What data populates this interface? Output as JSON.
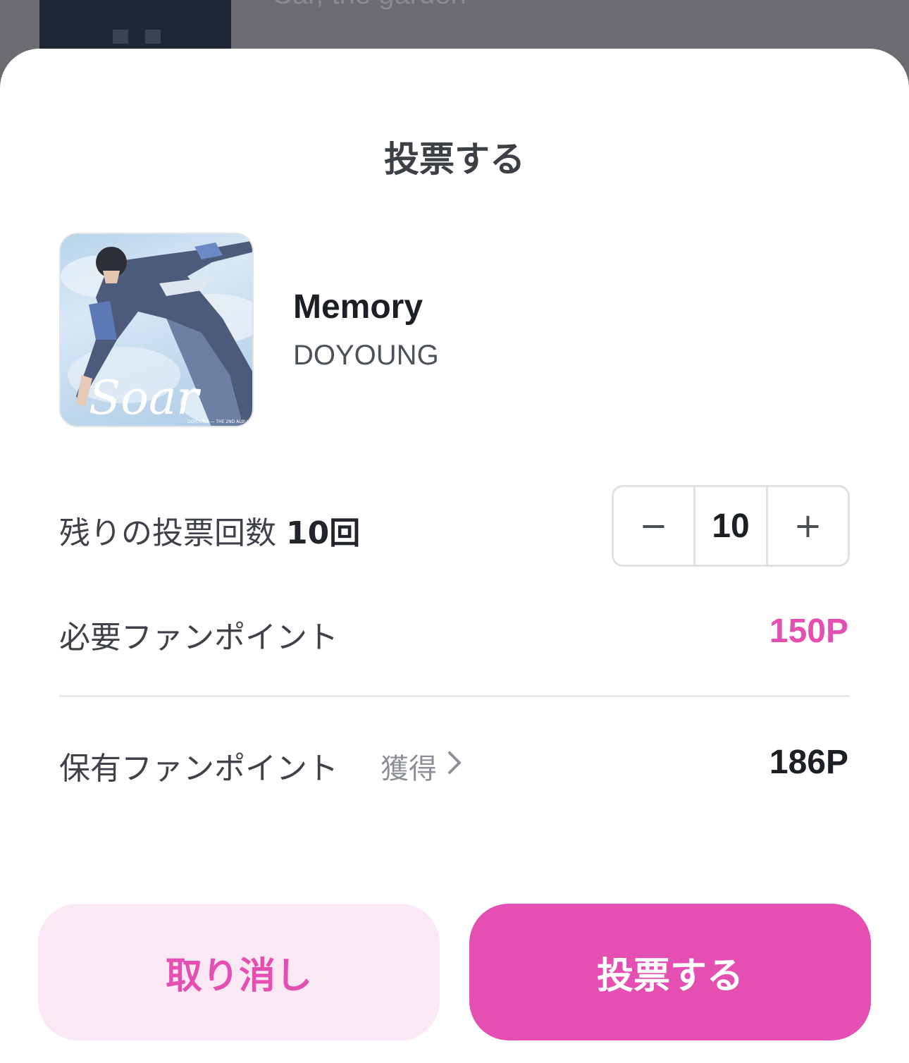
{
  "background": {
    "partial_title": "Car, the garden"
  },
  "sheet": {
    "title": "投票する"
  },
  "song": {
    "title": "Memory",
    "artist": "DOYOUNG",
    "album_art_text": "Soar",
    "album_art_subtext": "DOYOUNG — THE 2ND ALBUM"
  },
  "remaining": {
    "label": "残りの投票回数",
    "count": "10回"
  },
  "stepper": {
    "minus": "−",
    "value": "10",
    "plus": "+"
  },
  "required_points": {
    "label": "必要ファンポイント",
    "value": "150P"
  },
  "owned_points": {
    "label": "保有ファンポイント",
    "earn_link": "獲得",
    "value": "186P"
  },
  "buttons": {
    "cancel": "取り消し",
    "vote": "投票する"
  },
  "colors": {
    "accent": "#e44fb1",
    "accent_light": "#fae8f4",
    "text_primary": "#1c1f24",
    "text_secondary": "#3f4349",
    "divider": "#e4e6ea"
  }
}
